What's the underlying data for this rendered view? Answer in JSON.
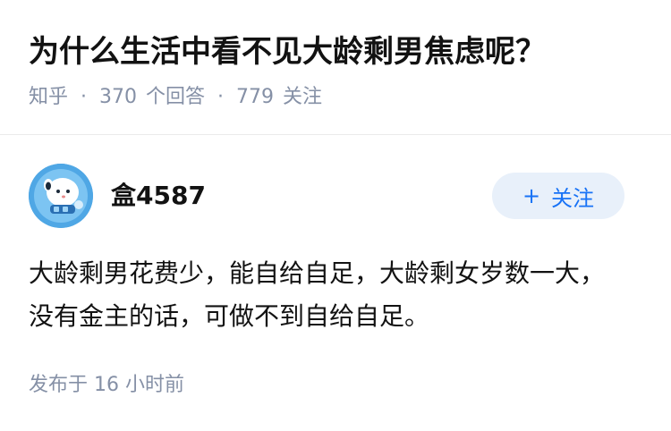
{
  "question": {
    "title": "为什么生活中看不见大龄剩男焦虑呢？",
    "source": "知乎",
    "answer_count": "370",
    "answer_label": "个回答",
    "follower_count": "779",
    "follower_label": "关注",
    "separator": "·"
  },
  "answer": {
    "author_name": "盒4587",
    "follow_label": "关注",
    "follow_icon": "plus-icon",
    "avatar_icon": "cartoon-avatar",
    "content": "大龄剩男花费少，能自给自足，大龄剩女岁数一大，没有金主的话，可做不到自给自足。",
    "published": "发布于  16 小时前"
  },
  "colors": {
    "text_primary": "#121212",
    "text_secondary": "#8590a6",
    "follow_bg": "#e8f0fa",
    "follow_text": "#1772f6",
    "avatar_bg": "#4fa7e5"
  }
}
